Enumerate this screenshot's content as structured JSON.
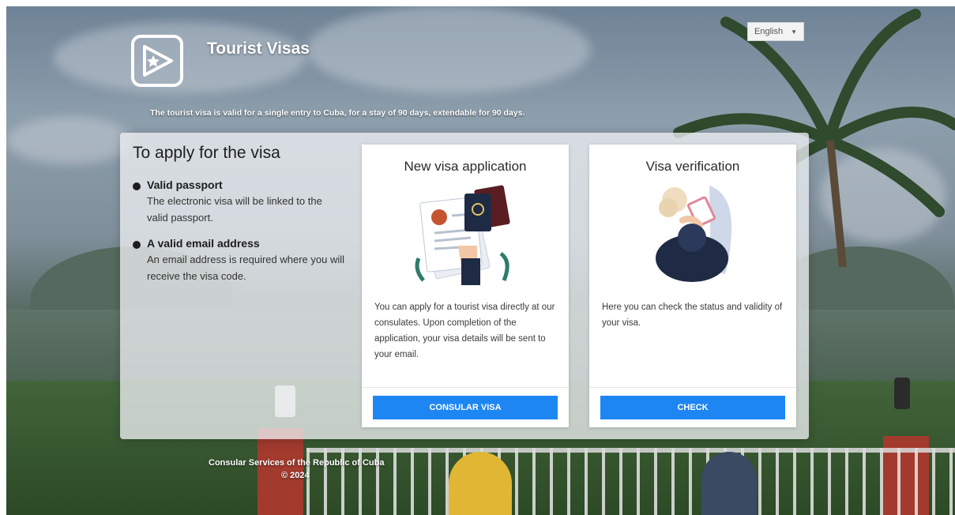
{
  "header": {
    "app_title": "Tourist Visas",
    "language_label": "English",
    "intro_text": "The tourist visa is valid for a single entry to Cuba, for a stay of 90 days, extendable for 90 days."
  },
  "requirements": {
    "heading": "To apply for the visa",
    "items": [
      {
        "title": "Valid passport",
        "description": "The electronic visa will be linked to the valid passport."
      },
      {
        "title": "A valid email address",
        "description": "An email address is required where you will receive the visa code."
      }
    ]
  },
  "cards": [
    {
      "title": "New visa application",
      "description": "You can apply for a tourist visa directly at our consulates. Upon completion of the application, your visa details will be sent to your email.",
      "button_label": "CONSULAR VISA",
      "icon": "passport-application-icon"
    },
    {
      "title": "Visa verification",
      "description": "Here you can check the status and validity of your visa.",
      "button_label": "CHECK",
      "icon": "visa-verification-icon"
    }
  ],
  "footer": {
    "line1": "Consular Services of the Republic of Cuba",
    "line2": "© 2024"
  },
  "colors": {
    "primary_button": "#1e86f2",
    "panel_bg": "#eceef1"
  }
}
